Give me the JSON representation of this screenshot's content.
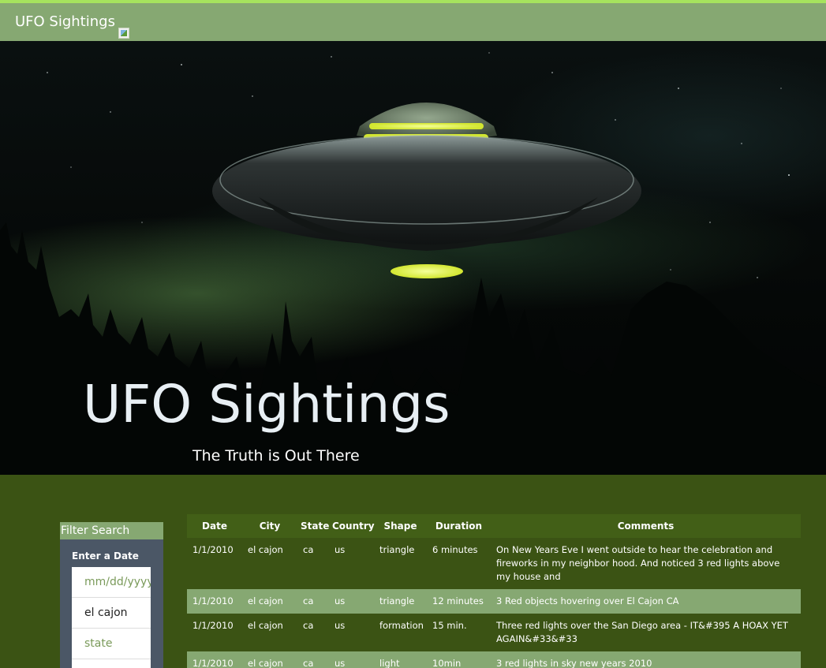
{
  "navbar": {
    "brand": "UFO Sightings"
  },
  "hero": {
    "title": "UFO Sightings",
    "subtitle": "The Truth is Out There"
  },
  "filter": {
    "heading": "Filter Search",
    "date_label": "Enter a Date",
    "date_placeholder": "mm/dd/yyyy",
    "city_value": "el cajon",
    "state_placeholder": "state"
  },
  "table": {
    "headers": [
      "Date",
      "City",
      "State",
      "Country",
      "Shape",
      "Duration",
      "Comments"
    ],
    "rows": [
      [
        "1/1/2010",
        "el cajon",
        "ca",
        "us",
        "triangle",
        "6 minutes",
        "On New Years Eve I went outside to hear the celebration and fireworks in my neighbor hood. And noticed 3 red lights above my house and"
      ],
      [
        "1/1/2010",
        "el cajon",
        "ca",
        "us",
        "triangle",
        "12 minutes",
        "3 Red objects hovering over El Cajon CA"
      ],
      [
        "1/1/2010",
        "el cajon",
        "ca",
        "us",
        "formation",
        "15 min.",
        "Three red lights over the San Diego area - IT&#395 A HOAX YET AGAIN&#33&#33"
      ],
      [
        "1/1/2010",
        "el cajon",
        "ca",
        "us",
        "light",
        "10min",
        "3 red lights in sky new years 2010"
      ]
    ]
  },
  "colors": {
    "nav": "#86a872",
    "accent_line": "#a6e35e",
    "page_bg": "#3b5314",
    "table_header": "#425f17",
    "filter_body": "#4b5766"
  }
}
